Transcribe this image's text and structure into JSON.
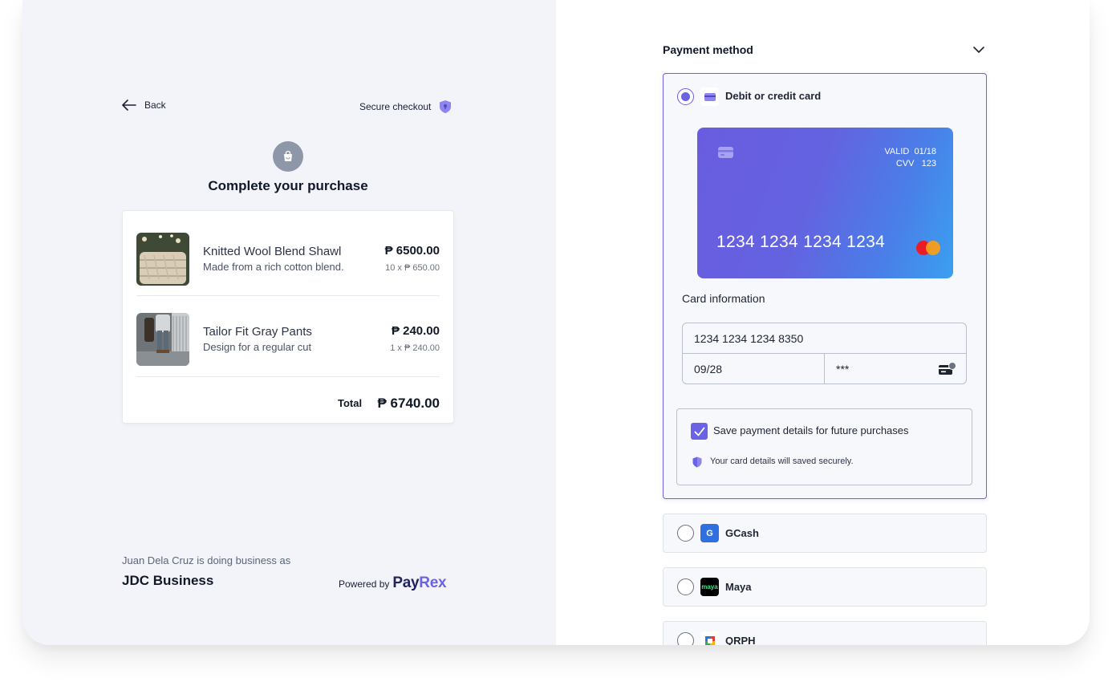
{
  "left": {
    "back_label": "Back",
    "secure_label": "Secure checkout",
    "title": "Complete your purchase",
    "items": [
      {
        "name": "Knitted Wool Blend Shawl",
        "desc": "Made from a rich cotton blend.",
        "price": "₱ 6500.00",
        "qty": "10 x ₱ 650.00"
      },
      {
        "name": "Tailor Fit Gray Pants",
        "desc": "Design for a regular cut",
        "price": "₱ 240.00",
        "qty": "1 x ₱ 240.00"
      }
    ],
    "total_label": "Total",
    "total_value": "₱ 6740.00",
    "business_line": "Juan Dela Cruz is doing business as",
    "business_name": "JDC Business",
    "powered_by": "Powered by",
    "brand_part1": "Pay",
    "brand_part2": "Rex"
  },
  "right": {
    "payment_method_title": "Payment method",
    "card_option_label": "Debit or credit card",
    "card_preview": {
      "valid_label": "VALID",
      "valid_value": "01/18",
      "cvv_label": "CVV",
      "cvv_value": "123",
      "number": "1234 1234 1234 1234"
    },
    "card_info_label": "Card information",
    "card_number_value": "1234 1234 1234 8350",
    "expiry_value": "09/28",
    "cvv_value": "***",
    "save_label": "Save payment details for future purchases",
    "save_note": "Your card details will saved securely.",
    "other_options": [
      {
        "label": "GCash",
        "icon_text": "G"
      },
      {
        "label": "Maya",
        "icon_text": "maya"
      },
      {
        "label": "QRPH"
      }
    ]
  },
  "colors": {
    "accent": "#6b63e6",
    "left_bg": "#f2f4f9",
    "card_gradient_start": "#6a5ce0",
    "card_gradient_end": "#3aa0f0",
    "gcash": "#2f6fe0",
    "maya": "#000000"
  },
  "icons": [
    "back-arrow-icon",
    "shield-icon",
    "shopping-bag-icon",
    "chevron-down-icon",
    "card-icon",
    "mastercard-icon",
    "cvv-card-icon",
    "check-icon",
    "gcash-icon",
    "maya-icon",
    "qrph-icon"
  ]
}
